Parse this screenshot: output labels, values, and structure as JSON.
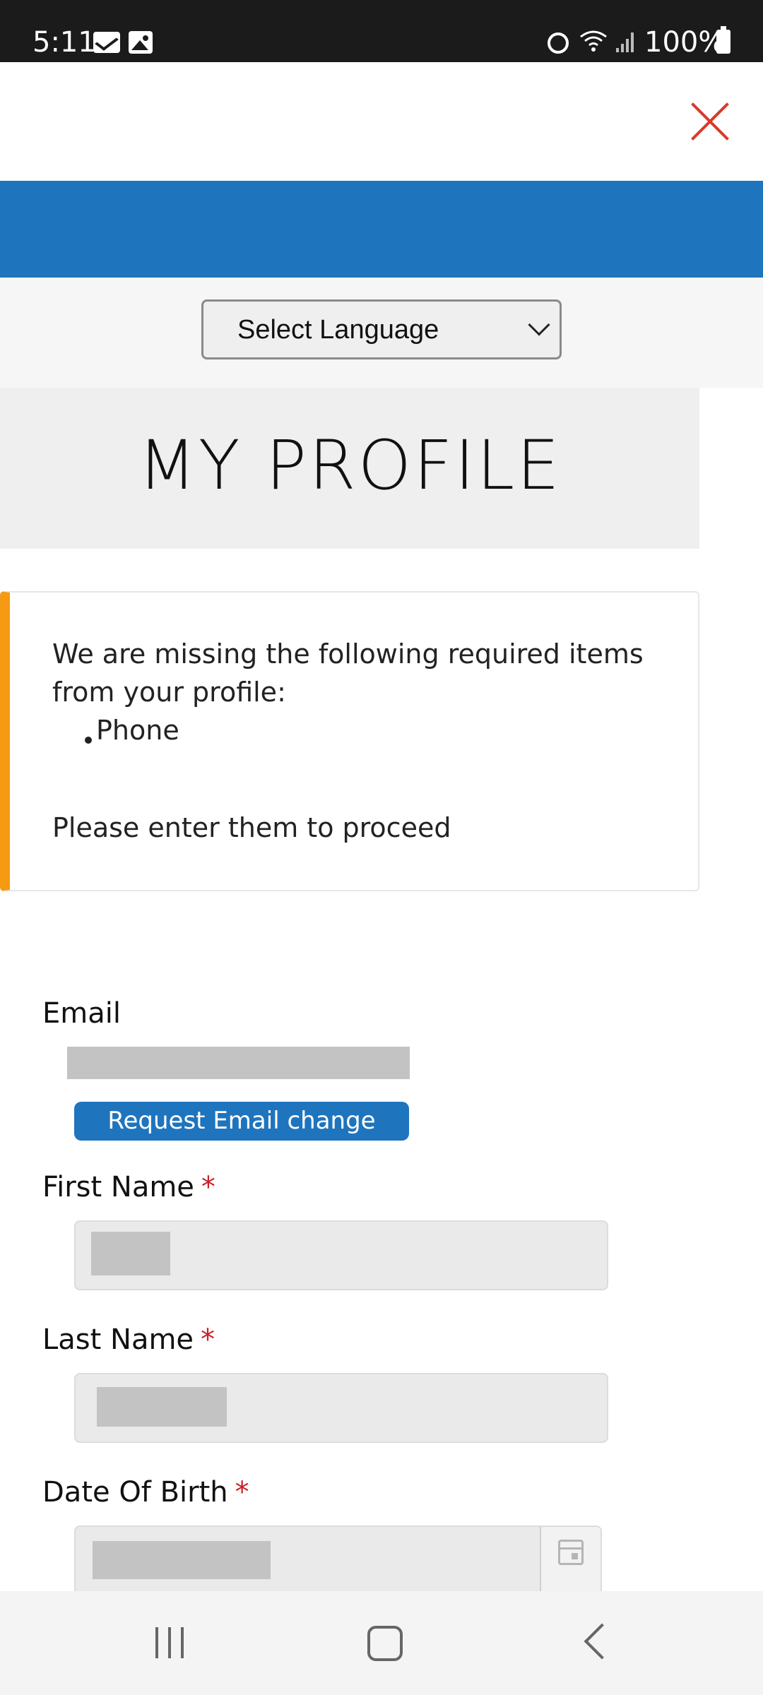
{
  "status_bar": {
    "time": "5:11",
    "battery": "100%",
    "icons": [
      "mail-icon",
      "image-icon",
      "alarm-icon",
      "wifi-icon",
      "signal-icon",
      "battery-icon"
    ]
  },
  "header": {
    "close_icon": "close-icon",
    "accent_color": "#1f74be",
    "close_color": "#d83a2a"
  },
  "language": {
    "selected": "Select Language"
  },
  "page": {
    "title": "MY PROFILE"
  },
  "alert": {
    "line1": "We are missing the following required items",
    "line2": "from your profile:",
    "items": [
      "Phone"
    ],
    "line3": "Please enter them to proceed",
    "accent_color": "#f59a12"
  },
  "form": {
    "email": {
      "label": "Email",
      "button_label": "Request Email change"
    },
    "first_name": {
      "label": "First Name",
      "required_mark": "*"
    },
    "last_name": {
      "label": "Last Name",
      "required_mark": "*"
    },
    "date_of_birth": {
      "label": "Date Of Birth",
      "required_mark": "*",
      "picker_icon": "calendar-icon"
    }
  },
  "nav_bar": {
    "buttons": [
      "recents-icon",
      "home-icon",
      "back-icon"
    ]
  }
}
